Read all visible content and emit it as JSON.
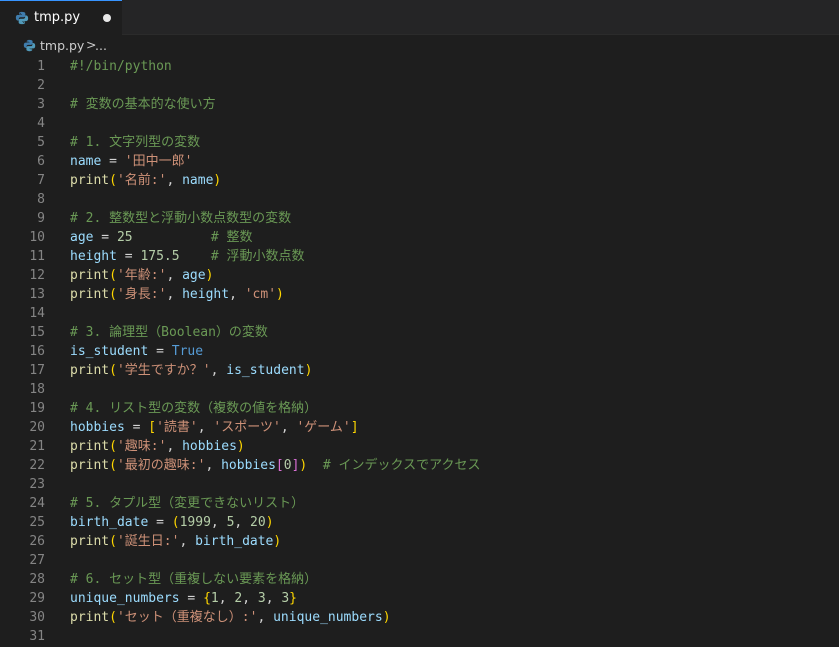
{
  "tab": {
    "filename": "tmp.py",
    "modified": true,
    "icon": "python-icon"
  },
  "breadcrumb": {
    "filename": "tmp.py",
    "separator": ">",
    "ellipsis": "..."
  },
  "colors": {
    "comment": "#6a9955",
    "variable": "#9cdcfe",
    "string": "#ce9178",
    "number": "#b5cea8",
    "function": "#dcdcaa",
    "keyword": "#569cd6",
    "bracket1": "#ffd700",
    "bracket2": "#da70d6",
    "background": "#1e1e1e"
  },
  "lines": [
    {
      "n": "1",
      "t": [
        [
          "comment",
          "#!/bin/python"
        ]
      ]
    },
    {
      "n": "2",
      "t": []
    },
    {
      "n": "3",
      "t": [
        [
          "comment",
          "# 変数の基本的な使い方"
        ]
      ]
    },
    {
      "n": "4",
      "t": []
    },
    {
      "n": "5",
      "t": [
        [
          "comment",
          "# 1. 文字列型の変数"
        ]
      ]
    },
    {
      "n": "6",
      "t": [
        [
          "var",
          "name"
        ],
        [
          "op",
          " = "
        ],
        [
          "str",
          "'田中一郎'"
        ]
      ]
    },
    {
      "n": "7",
      "t": [
        [
          "fn",
          "print"
        ],
        [
          "p1",
          "("
        ],
        [
          "str",
          "'名前:'"
        ],
        [
          "op",
          ", "
        ],
        [
          "var",
          "name"
        ],
        [
          "p1",
          ")"
        ]
      ]
    },
    {
      "n": "8",
      "t": []
    },
    {
      "n": "9",
      "t": [
        [
          "comment",
          "# 2. 整数型と浮動小数点数型の変数"
        ]
      ]
    },
    {
      "n": "10",
      "t": [
        [
          "var",
          "age"
        ],
        [
          "op",
          " = "
        ],
        [
          "num",
          "25"
        ],
        [
          "op",
          "          "
        ],
        [
          "comment",
          "# 整数"
        ]
      ]
    },
    {
      "n": "11",
      "t": [
        [
          "var",
          "height"
        ],
        [
          "op",
          " = "
        ],
        [
          "num",
          "175.5"
        ],
        [
          "op",
          "    "
        ],
        [
          "comment",
          "# 浮動小数点数"
        ]
      ]
    },
    {
      "n": "12",
      "t": [
        [
          "fn",
          "print"
        ],
        [
          "p1",
          "("
        ],
        [
          "str",
          "'年齢:'"
        ],
        [
          "op",
          ", "
        ],
        [
          "var",
          "age"
        ],
        [
          "p1",
          ")"
        ]
      ]
    },
    {
      "n": "13",
      "t": [
        [
          "fn",
          "print"
        ],
        [
          "p1",
          "("
        ],
        [
          "str",
          "'身長:'"
        ],
        [
          "op",
          ", "
        ],
        [
          "var",
          "height"
        ],
        [
          "op",
          ", "
        ],
        [
          "str",
          "'cm'"
        ],
        [
          "p1",
          ")"
        ]
      ]
    },
    {
      "n": "14",
      "t": []
    },
    {
      "n": "15",
      "t": [
        [
          "comment",
          "# 3. 論理型（Boolean）の変数"
        ]
      ]
    },
    {
      "n": "16",
      "t": [
        [
          "var",
          "is_student"
        ],
        [
          "op",
          " = "
        ],
        [
          "kw",
          "True"
        ]
      ]
    },
    {
      "n": "17",
      "t": [
        [
          "fn",
          "print"
        ],
        [
          "p1",
          "("
        ],
        [
          "str",
          "'学生ですか？'"
        ],
        [
          "op",
          ", "
        ],
        [
          "var",
          "is_student"
        ],
        [
          "p1",
          ")"
        ]
      ]
    },
    {
      "n": "18",
      "t": []
    },
    {
      "n": "19",
      "t": [
        [
          "comment",
          "# 4. リスト型の変数（複数の値を格納）"
        ]
      ]
    },
    {
      "n": "20",
      "t": [
        [
          "var",
          "hobbies"
        ],
        [
          "op",
          " = "
        ],
        [
          "p1",
          "["
        ],
        [
          "str",
          "'読書'"
        ],
        [
          "op",
          ", "
        ],
        [
          "str",
          "'スポーツ'"
        ],
        [
          "op",
          ", "
        ],
        [
          "str",
          "'ゲーム'"
        ],
        [
          "p1",
          "]"
        ]
      ]
    },
    {
      "n": "21",
      "t": [
        [
          "fn",
          "print"
        ],
        [
          "p1",
          "("
        ],
        [
          "str",
          "'趣味:'"
        ],
        [
          "op",
          ", "
        ],
        [
          "var",
          "hobbies"
        ],
        [
          "p1",
          ")"
        ]
      ]
    },
    {
      "n": "22",
      "t": [
        [
          "fn",
          "print"
        ],
        [
          "p1",
          "("
        ],
        [
          "str",
          "'最初の趣味:'"
        ],
        [
          "op",
          ", "
        ],
        [
          "var",
          "hobbies"
        ],
        [
          "p2",
          "["
        ],
        [
          "num",
          "0"
        ],
        [
          "p2",
          "]"
        ],
        [
          "p1",
          ")"
        ],
        [
          "op",
          "  "
        ],
        [
          "comment",
          "# インデックスでアクセス"
        ]
      ]
    },
    {
      "n": "23",
      "t": []
    },
    {
      "n": "24",
      "t": [
        [
          "comment",
          "# 5. タプル型（変更できないリスト）"
        ]
      ]
    },
    {
      "n": "25",
      "t": [
        [
          "var",
          "birth_date"
        ],
        [
          "op",
          " = "
        ],
        [
          "p1",
          "("
        ],
        [
          "num",
          "1999"
        ],
        [
          "op",
          ", "
        ],
        [
          "num",
          "5"
        ],
        [
          "op",
          ", "
        ],
        [
          "num",
          "20"
        ],
        [
          "p1",
          ")"
        ]
      ]
    },
    {
      "n": "26",
      "t": [
        [
          "fn",
          "print"
        ],
        [
          "p1",
          "("
        ],
        [
          "str",
          "'誕生日:'"
        ],
        [
          "op",
          ", "
        ],
        [
          "var",
          "birth_date"
        ],
        [
          "p1",
          ")"
        ]
      ]
    },
    {
      "n": "27",
      "t": []
    },
    {
      "n": "28",
      "t": [
        [
          "comment",
          "# 6. セット型（重複しない要素を格納）"
        ]
      ]
    },
    {
      "n": "29",
      "t": [
        [
          "var",
          "unique_numbers"
        ],
        [
          "op",
          " = "
        ],
        [
          "p1",
          "{"
        ],
        [
          "num",
          "1"
        ],
        [
          "op",
          ", "
        ],
        [
          "num",
          "2"
        ],
        [
          "op",
          ", "
        ],
        [
          "num",
          "3"
        ],
        [
          "op",
          ", "
        ],
        [
          "num",
          "3"
        ],
        [
          "p1",
          "}"
        ]
      ]
    },
    {
      "n": "30",
      "t": [
        [
          "fn",
          "print"
        ],
        [
          "p1",
          "("
        ],
        [
          "str",
          "'セット（重複なし）:'"
        ],
        [
          "op",
          ", "
        ],
        [
          "var",
          "unique_numbers"
        ],
        [
          "p1",
          ")"
        ]
      ]
    },
    {
      "n": "31",
      "t": []
    }
  ]
}
